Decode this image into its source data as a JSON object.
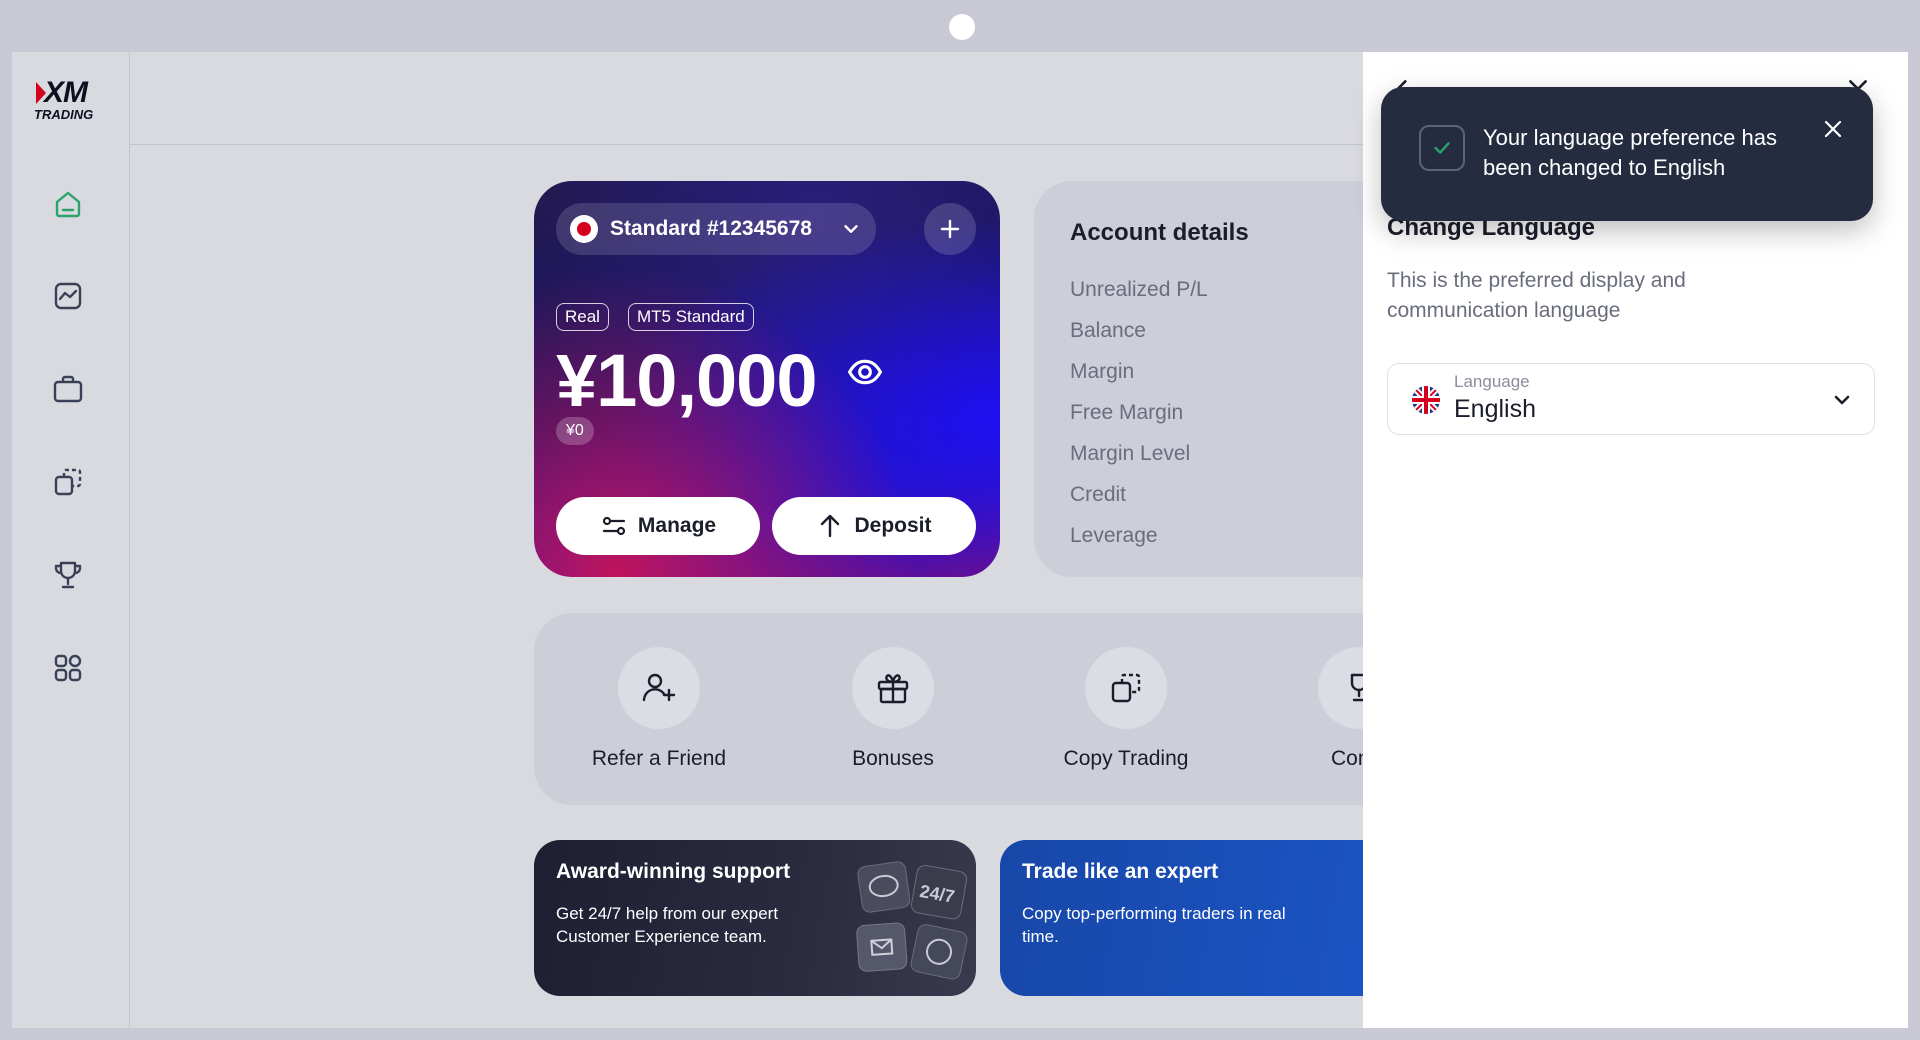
{
  "brand": {
    "logo_main": "XM",
    "logo_sub": "TRADING",
    "accent": "#2aa36a",
    "logo_red": "#d4001f"
  },
  "sidebar": {
    "items": [
      {
        "name": "home-icon",
        "active": true
      },
      {
        "name": "chart-icon",
        "active": false
      },
      {
        "name": "briefcase-icon",
        "active": false
      },
      {
        "name": "copy-icon",
        "active": false
      },
      {
        "name": "trophy-icon",
        "active": false
      },
      {
        "name": "apps-icon",
        "active": false
      }
    ]
  },
  "account_card": {
    "account_label": "Standard #12345678",
    "tags": [
      "Real",
      "MT5 Standard"
    ],
    "balance": "¥10,000",
    "secondary_balance": "¥0",
    "manage_label": "Manage",
    "deposit_label": "Deposit"
  },
  "account_details": {
    "title": "Account details",
    "rows": [
      "Unrealized P/L",
      "Balance",
      "Margin",
      "Free Margin",
      "Margin Level",
      "Credit",
      "Leverage"
    ]
  },
  "quick_actions": [
    {
      "label": "Refer a Friend",
      "icon": "refer-friend-icon"
    },
    {
      "label": "Bonuses",
      "icon": "gift-icon"
    },
    {
      "label": "Copy Trading",
      "icon": "copy-trading-icon"
    },
    {
      "label": "Comp",
      "icon": "trophy-icon"
    }
  ],
  "promos": [
    {
      "title": "Award-winning support",
      "text": "Get 24/7 help from our expert Customer Experience team.",
      "color": "#22223a"
    },
    {
      "title": "Trade like an expert",
      "text": "Copy top-performing traders in real time.",
      "color": "#1a4fb8"
    }
  ],
  "panel": {
    "title": "Change Language",
    "description": "This is the preferred display and communication language",
    "language_label": "Language",
    "language_value": "English"
  },
  "toast": {
    "message": "Your language preference has been changed to English"
  }
}
